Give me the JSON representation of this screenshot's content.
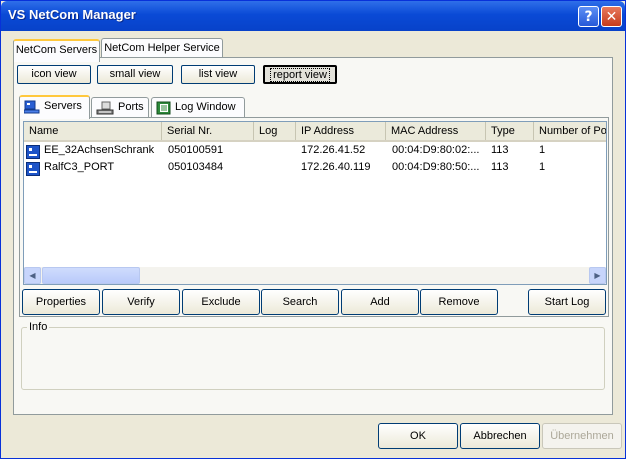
{
  "window": {
    "title": "VS NetCom Manager"
  },
  "main_tabs": [
    {
      "label": "NetCom Servers"
    },
    {
      "label": "NetCom Helper Service"
    }
  ],
  "view_buttons": [
    {
      "label": "icon view"
    },
    {
      "label": "small view"
    },
    {
      "label": "list view"
    },
    {
      "label": "report view"
    }
  ],
  "sub_tabs": [
    {
      "label": "Servers",
      "icon": "servers-icon"
    },
    {
      "label": "Ports",
      "icon": "ports-icon"
    },
    {
      "label": "Log Window",
      "icon": "log-window-icon"
    }
  ],
  "table": {
    "columns": [
      "Name",
      "Serial Nr.",
      "Log",
      "IP Address",
      "MAC Address",
      "Type",
      "Number of Por"
    ],
    "rows": [
      {
        "name": "EE_32AchsenSchrank",
        "serial": "050100591",
        "log": "",
        "ip": "172.26.41.52",
        "mac": "00:04:D9:80:02:...",
        "type": "113",
        "ports": "1"
      },
      {
        "name": "RalfC3_PORT",
        "serial": "050103484",
        "log": "",
        "ip": "172.26.40.119",
        "mac": "00:04:D9:80:50:...",
        "type": "113",
        "ports": "1"
      }
    ]
  },
  "actions": [
    {
      "label": "Properties"
    },
    {
      "label": "Verify"
    },
    {
      "label": "Exclude"
    },
    {
      "label": "Search"
    },
    {
      "label": "Add"
    },
    {
      "label": "Remove"
    },
    {
      "label": "Start Log"
    }
  ],
  "info": {
    "label": "Info"
  },
  "footer": {
    "ok": "OK",
    "cancel": "Abbrechen",
    "apply": "Übernehmen"
  },
  "colors": {
    "titlebar": "#0a4ad6",
    "active_tab_accent": "#ffc83c"
  }
}
